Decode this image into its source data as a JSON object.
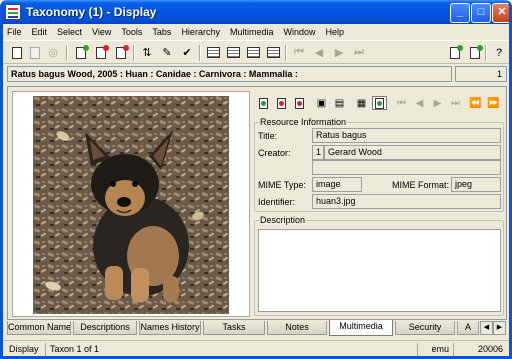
{
  "window": {
    "title": "Taxonomy (1) - Display",
    "minimize_glyph": "_",
    "maximize_glyph": "□",
    "close_glyph": "✕"
  },
  "menu": [
    "File",
    "Edit",
    "Select",
    "View",
    "Tools",
    "Tabs",
    "Hierarchy",
    "Multimedia",
    "Window",
    "Help"
  ],
  "breadcrumb": {
    "text": "Ratus bagus Wood, 2005 : Huan : Canidae : Carnivora : Mammalia :",
    "count": "1"
  },
  "resource_information": {
    "group_title": "Resource Information",
    "title_label": "Title:",
    "title_value": "Ratus bagus",
    "creator_label": "Creator:",
    "creator_index": "1",
    "creator_value": "Gerard Wood",
    "mime_type_label": "MIME Type:",
    "mime_type_value": "image",
    "mime_format_label": "MIME Format:",
    "mime_format_value": "jpeg",
    "identifier_label": "Identifier:",
    "identifier_value": "huan3.jpg"
  },
  "description": {
    "group_title": "Description",
    "value": ""
  },
  "tabs": {
    "items": [
      "Common Names",
      "Descriptions",
      "Names History",
      "Tasks",
      "Notes",
      "Multimedia",
      "Security",
      "A"
    ],
    "active": "Multimedia",
    "scroll_left": "◀",
    "scroll_right": "▶"
  },
  "status": {
    "mode": "Display",
    "record": "Taxon 1 of 1",
    "module": "emu",
    "id": "20006"
  },
  "icons": {
    "image_subject": "puppy-photo",
    "toolbar": [
      "new-record-icon",
      "save-icon",
      "disabled-icon",
      "import-icon",
      "delete-icon",
      "delete-record-icon",
      "sort-icon",
      "edit-icon",
      "spellcheck-icon",
      "view-icon",
      "list-view-icon",
      "table-view-icon",
      "page-view-icon",
      "first-icon",
      "previous-icon",
      "next-icon",
      "last-icon",
      "attach-icon",
      "detach-icon",
      "help-icon"
    ]
  },
  "colors": {
    "titlebar": "#0054e3",
    "window_face": "#ece9d8",
    "window_border": "#0a53d8",
    "close_button": "#c4421d"
  }
}
